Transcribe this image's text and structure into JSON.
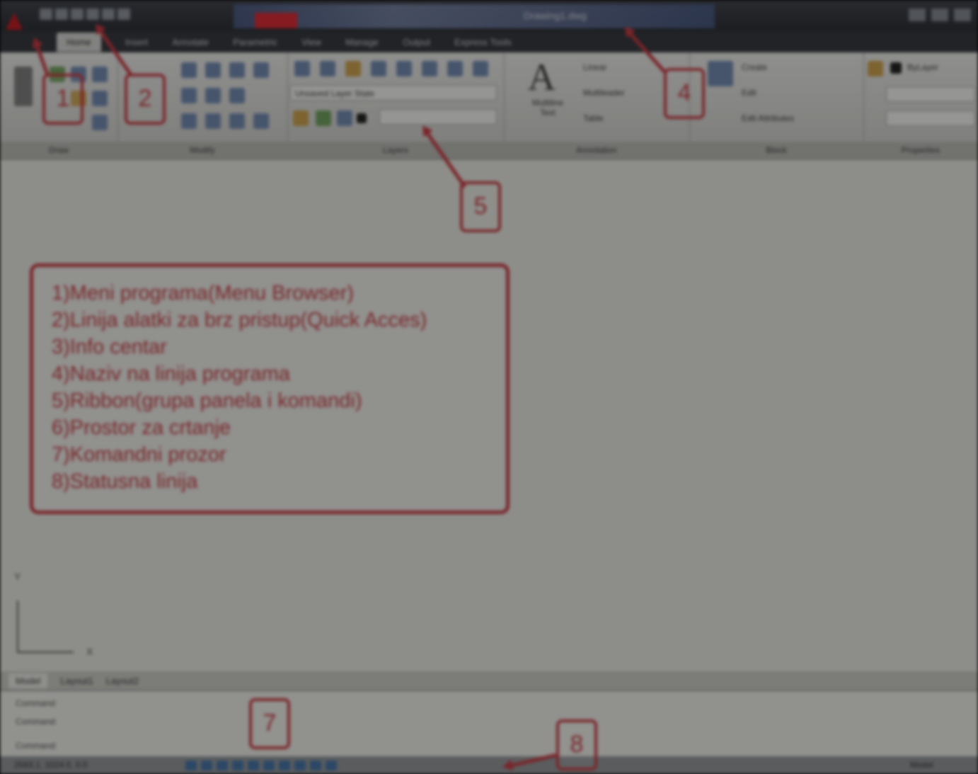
{
  "window": {
    "title": "Drawing1.dwg"
  },
  "ribbon": {
    "tabs": [
      "Home",
      "Insert",
      "Annotate",
      "Parametric",
      "View",
      "Manage",
      "Output",
      "Express Tools"
    ],
    "panels": [
      "Draw",
      "Modify",
      "Layers",
      "Annotation",
      "Block",
      "Properties"
    ],
    "layer_combo": "Unsaved Layer State",
    "annotation": {
      "big_tool": "Multiline Text",
      "dimension": "Linear",
      "multileader": "Multileader",
      "table": "Table"
    },
    "block": {
      "create": "Create",
      "edit": "Edit",
      "attributes": "Edit Attributes"
    },
    "properties": {
      "color": "ByLayer"
    }
  },
  "annotations": {
    "badges": [
      "1",
      "2",
      "4",
      "5",
      "7",
      "8"
    ],
    "legend": [
      "1)Meni programa(Menu Browser)",
      "2)Linija alatki za brz pristup(Quick Acces)",
      "3)Info centar",
      "4)Naziv na linija programa",
      "5)Ribbon(grupa panela i komandi)",
      "6)Prostor za crtanje",
      "7)Komandni prozor",
      "8)Statusna linija"
    ]
  },
  "drawing": {
    "ucs_y": "Y",
    "ucs_x": "X"
  },
  "layout_tabs": [
    "Model",
    "Layout1",
    "Layout2"
  ],
  "command": {
    "line1": "Command:",
    "line2": "Command:",
    "line3": "Command:"
  },
  "status": {
    "coords": "2583.1, 1024.0, 0.0",
    "right": "Model"
  }
}
